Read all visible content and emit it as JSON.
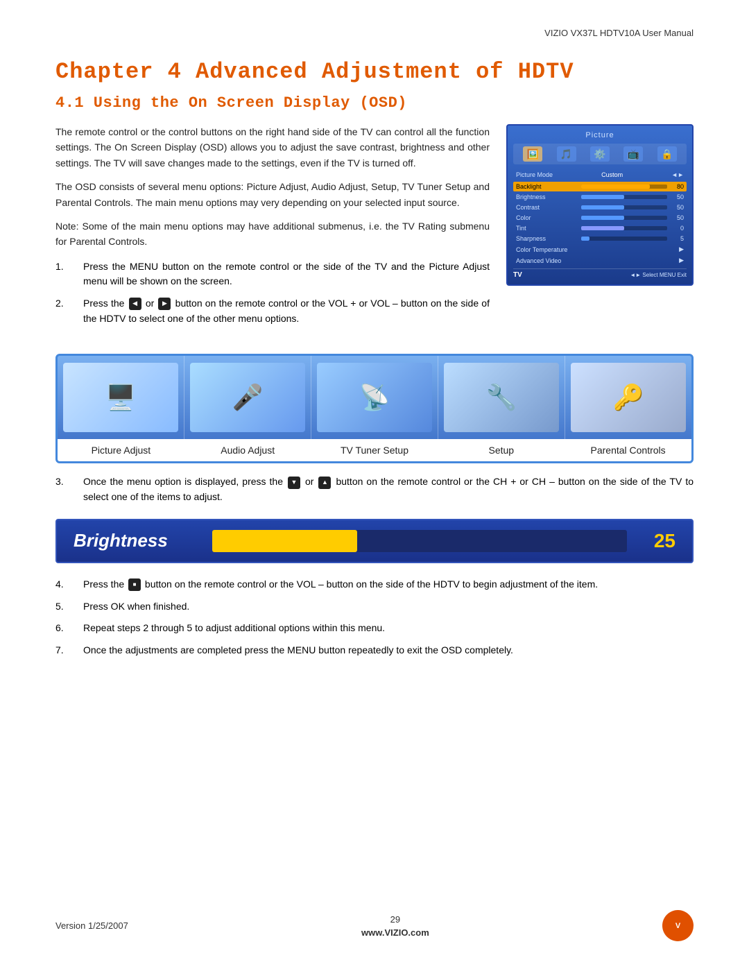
{
  "header": {
    "manual_title": "VIZIO VX37L HDTV10A User Manual"
  },
  "chapter": {
    "title": "Chapter 4 Advanced Adjustment of HDTV",
    "section_title": "4.1 Using the On Screen Display (OSD)"
  },
  "intro_paragraphs": [
    "The remote control or the control buttons on the right hand side of the TV can control all the function settings.  The On Screen Display (OSD) allows you to adjust the save contrast, brightness and other settings.  The TV will save changes made to the settings, even if the TV is turned off.",
    "The OSD consists of several menu options: Picture Adjust, Audio Adjust, Setup, TV Tuner Setup and Parental Controls.  The main menu options may very depending on your selected input source.",
    "Note:  Some of the main menu options may have additional submenus, i.e. the TV Rating submenu for Parental Controls."
  ],
  "steps": [
    {
      "num": "1.",
      "text": "Press the MENU button on the remote control or the side of the TV and the Picture Adjust menu will be shown on the screen."
    },
    {
      "num": "2.",
      "text_before": "Press the",
      "text_middle": "or",
      "text_after": "button on the remote control or the VOL + or VOL – button on the side of the HDTV to select one of the other menu options."
    },
    {
      "num": "3.",
      "text_before": "Once the menu option is displayed, press the",
      "text_middle": "or",
      "text_after": "button on the remote control or the CH + or CH – button on the side of the TV to select one of the items to adjust."
    },
    {
      "num": "4.",
      "text_before": "Press the",
      "text_after": "button on the remote control or the VOL – button on the side of the HDTV to begin adjustment of the item."
    },
    {
      "num": "5.",
      "text": "Press OK when finished."
    },
    {
      "num": "6.",
      "text": "Repeat steps 2 through 5 to adjust additional options within this menu."
    },
    {
      "num": "7.",
      "text": "Once the adjustments are completed press the MENU button repeatedly to exit the OSD completely."
    }
  ],
  "osd_panel": {
    "title": "Picture",
    "mode_label": "Picture Mode",
    "mode_value": "Custom",
    "rows": [
      {
        "label": "Backlight",
        "value": 80,
        "pct": 80,
        "highlight": true
      },
      {
        "label": "Brightness",
        "value": 50,
        "pct": 50
      },
      {
        "label": "Contrast",
        "value": 50,
        "pct": 50
      },
      {
        "label": "Color",
        "value": 50,
        "pct": 50
      },
      {
        "label": "Tint",
        "value": 0,
        "pct": 50
      },
      {
        "label": "Sharpness",
        "value": 5,
        "pct": 10
      },
      {
        "label": "Color Temperature",
        "value": "",
        "arrow": true
      },
      {
        "label": "Advanced Video",
        "value": "",
        "arrow": true
      }
    ],
    "bottom_left": "TV",
    "bottom_right": "◄► Select  MENU Exit"
  },
  "menu_strip": {
    "items": [
      {
        "label": "Picture Adjust",
        "icon": "🖥️"
      },
      {
        "label": "Audio Adjust",
        "icon": "🎤"
      },
      {
        "label": "TV Tuner Setup",
        "icon": "📡"
      },
      {
        "label": "Setup",
        "icon": "🔧"
      },
      {
        "label": "Parental Controls",
        "icon": "🔑"
      }
    ]
  },
  "brightness_bar": {
    "label": "Brightness",
    "value": "25",
    "fill_pct": 35
  },
  "footer": {
    "version": "Version 1/25/2007",
    "page_number": "29",
    "website": "www.VIZIO.com",
    "logo_text": "V"
  }
}
